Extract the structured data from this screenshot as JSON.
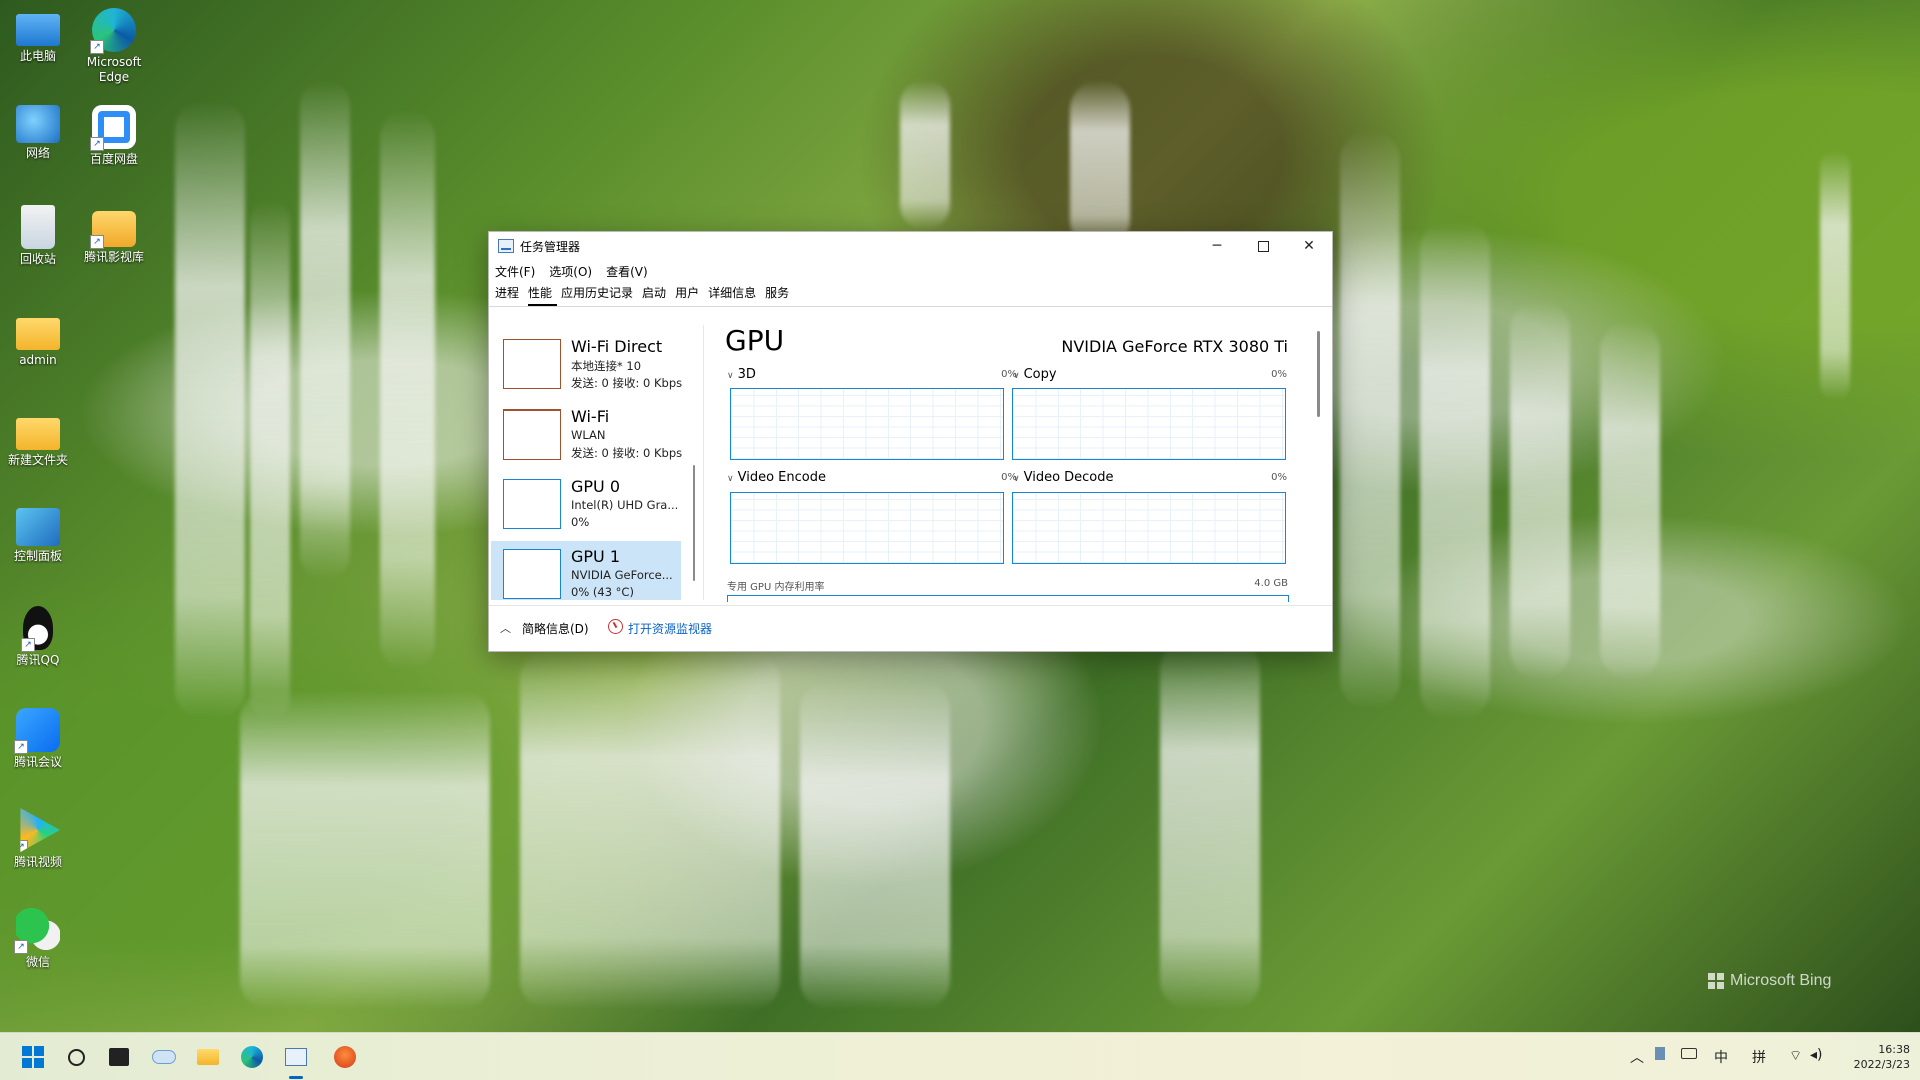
{
  "desktop": {
    "icons": [
      {
        "label": "此电脑"
      },
      {
        "label": "Microsoft Edge"
      },
      {
        "label": "网络"
      },
      {
        "label": "百度网盘"
      },
      {
        "label": "回收站"
      },
      {
        "label": "腾讯影视库"
      },
      {
        "label": "admin"
      },
      {
        "label": "新建文件夹"
      },
      {
        "label": "控制面板"
      },
      {
        "label": "腾讯QQ"
      },
      {
        "label": "腾讯会议"
      },
      {
        "label": "腾讯视频"
      },
      {
        "label": "微信"
      }
    ],
    "watermark": "Microsoft Bing"
  },
  "window": {
    "title": "任务管理器",
    "menu": [
      "文件(F)",
      "选项(O)",
      "查看(V)"
    ],
    "tabs": [
      "进程",
      "性能",
      "应用历史记录",
      "启动",
      "用户",
      "详细信息",
      "服务"
    ],
    "active_tab": "性能",
    "resources": [
      {
        "name": "Wi-Fi Direct",
        "line1": "本地连接* 10",
        "line2": "发送: 0 接收: 0 Kbps",
        "color": "#a0522d",
        "selected": false
      },
      {
        "name": "Wi-Fi",
        "line1": "WLAN",
        "line2": "发送: 0 接收: 0 Kbps",
        "color": "#a0522d",
        "selected": false
      },
      {
        "name": "GPU 0",
        "line1": "Intel(R) UHD Gra...",
        "line2": "0%",
        "color": "#1884d4",
        "selected": false
      },
      {
        "name": "GPU 1",
        "line1": "NVIDIA GeForce...",
        "line2": "0% (43 °C)",
        "color": "#1884d4",
        "selected": true
      }
    ],
    "detail": {
      "title": "GPU",
      "device": "NVIDIA GeForce RTX 3080 Ti",
      "engines": [
        {
          "name": "3D",
          "value": "0%"
        },
        {
          "name": "Copy",
          "value": "0%"
        },
        {
          "name": "Video Encode",
          "value": "0%"
        },
        {
          "name": "Video Decode",
          "value": "0%"
        }
      ],
      "memory_label": "专用 GPU 内存利用率",
      "memory_value": "4.0 GB"
    },
    "footer": {
      "brief": "简略信息(D)",
      "open_monitor": "打开资源监视器"
    }
  },
  "taskbar": {
    "ime_lang": "中",
    "ime_mode": "拼",
    "time": "16:38",
    "date": "2022/3/23"
  },
  "colors": {
    "accent": "#0067c0",
    "graph_border": "#1884d4",
    "network_border": "#a0522d",
    "selection": "#cce4f7"
  }
}
